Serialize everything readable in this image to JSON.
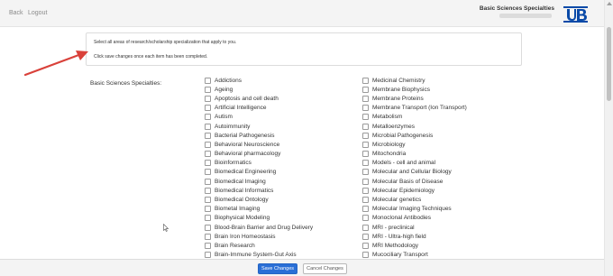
{
  "nav": {
    "back": "Back",
    "logout": "Logout"
  },
  "header": {
    "title": "Basic Sciences Specialties",
    "logo_icon": "ub-logo-icon"
  },
  "notice": {
    "line1": "Select all areas of research/scholarship specialization that apply to you.",
    "line2": "Click save changes once each item has been completed."
  },
  "field_label": "Basic Sciences Specialties:",
  "options_left": [
    "Addictions",
    "Ageing",
    "Apoptosis and cell death",
    "Artificial Intelligence",
    "Autism",
    "Autoimmunity",
    "Bacterial Pathogenesis",
    "Behavioral Neuroscience",
    "Behavioral pharmacology",
    "Bioinformatics",
    "Biomedical Engineering",
    "Biomedical Imaging",
    "Biomedical Informatics",
    "Biomedical Ontology",
    "Biometal Imaging",
    "Biophysical Modeling",
    "Blood-Brain Barrier and Drug Delivery",
    "Brain Iron Homeostasis",
    "Brain Research",
    "Brain-Immune System-Gut Axis"
  ],
  "options_right": [
    "Medicinal Chemistry",
    "Membrane Biophysics",
    "Membrane Proteins",
    "Membrane Transport (Ion Transport)",
    "Metabolism",
    "Metalloenzymes",
    "Microbial Pathogenesis",
    "Microbiology",
    "Mitochondria",
    "Models - cell and animal",
    "Molecular and Cellular Biology",
    "Molecular Basis of Disease",
    "Molecular Epidemiology",
    "Molecular genetics",
    "Molecular Imaging Techniques",
    "Monoclonal Antibodies",
    "MRI - preclinical",
    "MRI - Ultra-high field",
    "MRI Methodology",
    "Mucociliary Transport"
  ],
  "buttons": {
    "save": "Save Changes",
    "cancel": "Cancel Changes"
  },
  "colors": {
    "primary": "#2a6fd6",
    "annotation_arrow": "#d9413a",
    "logo": "#0a4aa8"
  }
}
